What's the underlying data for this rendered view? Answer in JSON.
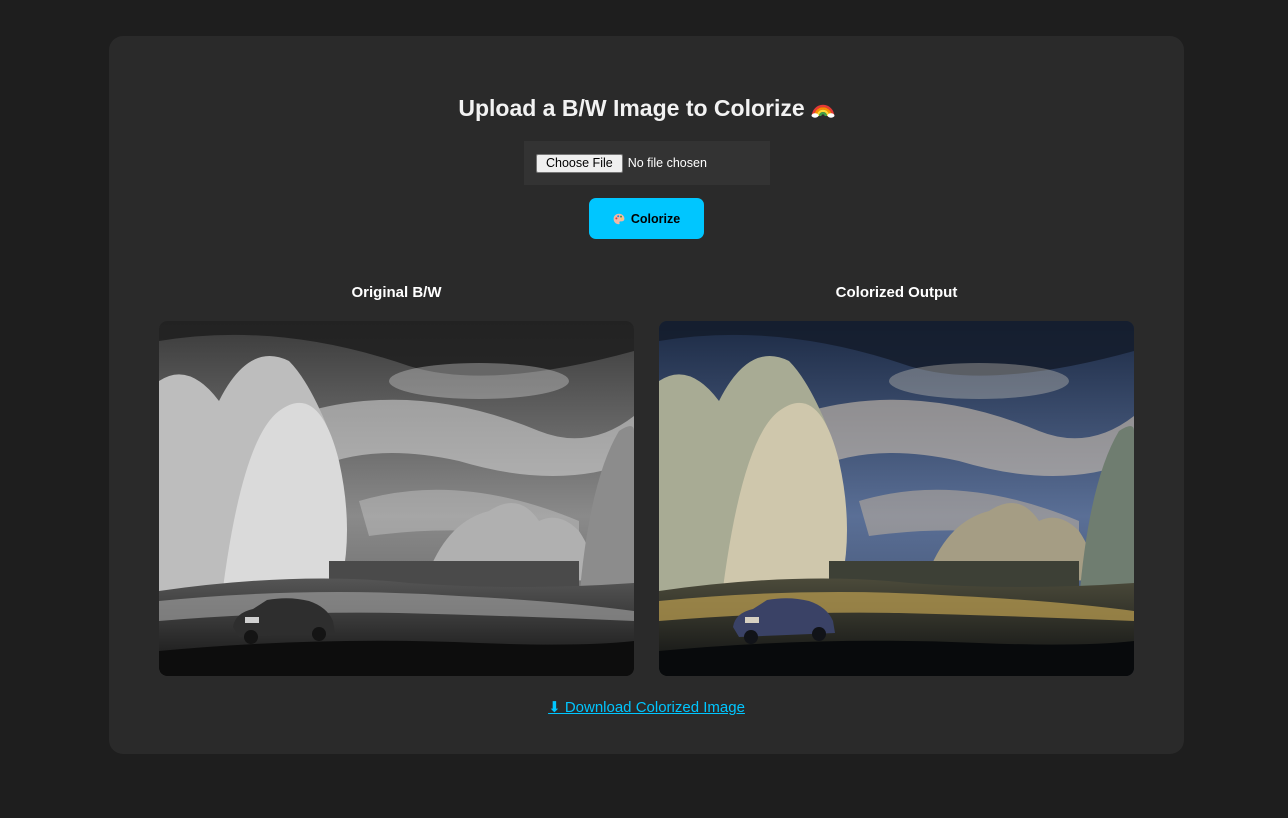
{
  "header": {
    "title": "Upload a B/W Image to Colorize",
    "title_icon": "rainbow-icon"
  },
  "upload": {
    "choose_label": "Choose File",
    "status_text": "No file chosen"
  },
  "actions": {
    "colorize_label": "Colorize",
    "colorize_icon": "palette-icon",
    "accent_color": "#00c6ff"
  },
  "results": {
    "original_caption": "Original B/W",
    "colorized_caption": "Colorized Output"
  },
  "download": {
    "icon": "down-arrow-icon",
    "label": "⬇ Download Colorized Image"
  },
  "colors": {
    "page_background": "#1e1e1e",
    "card_background": "#2a2a2a",
    "file_box_background": "#333333",
    "link_color": "#00c6ff"
  }
}
